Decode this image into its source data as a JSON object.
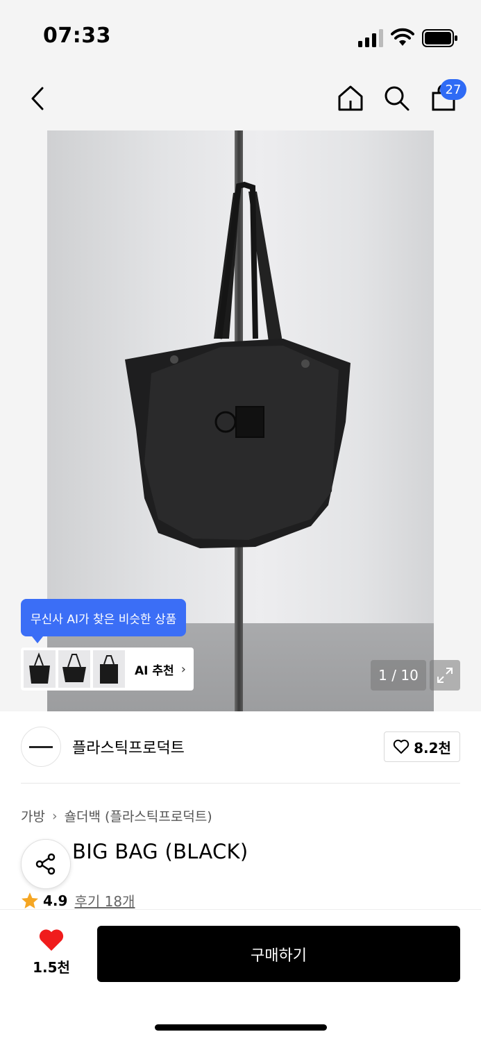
{
  "status": {
    "time": "07:33"
  },
  "nav": {
    "cart_count": "27"
  },
  "gallery": {
    "ai_tip": "무신사 AI가 찾은 비슷한 상품",
    "ai_label": "AI 추천",
    "pager": "1 / 10"
  },
  "brand": {
    "name": "플라스틱프로덕트",
    "likes": "8.2천"
  },
  "product": {
    "breadcrumb": [
      "가방",
      "숄더백 (플라스틱프로덕트)"
    ],
    "title": "BIG BAG (BLACK)",
    "rating": "4.9",
    "reviews": "후기 18개"
  },
  "bottom": {
    "wish_count": "1.5천",
    "buy_label": "구매하기"
  },
  "colors": {
    "accent": "#3b6ef6",
    "badge": "#2f6bf5",
    "heart": "#f01c1c",
    "star": "#f5a623"
  },
  "icons": [
    "back-icon",
    "home-icon",
    "search-icon",
    "shopping-bag-icon",
    "heart-icon",
    "share-icon",
    "star-icon",
    "expand-icon",
    "chevron-right-icon"
  ]
}
